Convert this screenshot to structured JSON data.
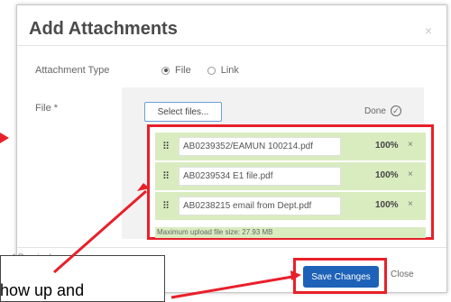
{
  "dialog": {
    "title": "Add Attachments",
    "close_symbol": "×",
    "attachment_type_label": "Attachment Type",
    "file_label": "File *",
    "radio_options": [
      {
        "label": "File",
        "checked": true
      },
      {
        "label": "Link",
        "checked": false
      }
    ],
    "select_files_label": "Select files...",
    "done_label": "Done",
    "done_icon": "check-circle-icon",
    "uploads": [
      {
        "name": "AB0239352/EAMUN 100214.pdf",
        "percent": "100%",
        "remove": "×"
      },
      {
        "name": "AB0239534 E1 file.pdf",
        "percent": "100%",
        "remove": "×"
      },
      {
        "name": "AB0238215 email from Dept.pdf",
        "percent": "100%",
        "remove": "×"
      }
    ],
    "max_upload_text": "Maximum upload file size: 27.93 MB",
    "required_text": "* Required",
    "save_label": "Save Changes",
    "close_label": "Close"
  },
  "callout": {
    "text": "how up and"
  },
  "colors": {
    "primary_button": "#1d62b8",
    "highlight_red": "#e8202a",
    "upload_row_bg": "#d9ecc0"
  }
}
